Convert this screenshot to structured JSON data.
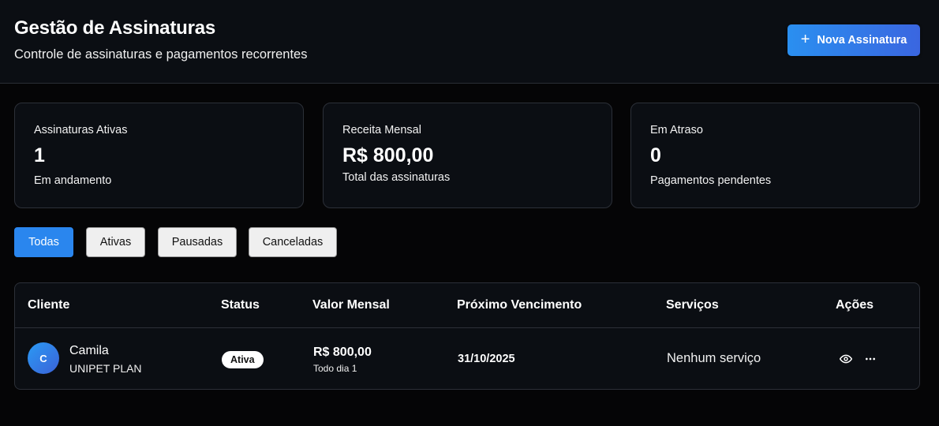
{
  "header": {
    "title": "Gestão de Assinaturas",
    "subtitle": "Controle de assinaturas e pagamentos recorrentes",
    "new_button_label": "Nova Assinatura",
    "new_button_icon": "plus-icon"
  },
  "stats": [
    {
      "label": "Assinaturas Ativas",
      "value": "1",
      "description": "Em andamento"
    },
    {
      "label": "Receita Mensal",
      "value": "R$ 800,00",
      "description": "Total das assinaturas"
    },
    {
      "label": "Em Atraso",
      "value": "0",
      "description": "Pagamentos pendentes"
    }
  ],
  "filters": [
    {
      "label": "Todas",
      "active": true
    },
    {
      "label": "Ativas",
      "active": false
    },
    {
      "label": "Pausadas",
      "active": false
    },
    {
      "label": "Canceladas",
      "active": false
    }
  ],
  "table": {
    "columns": [
      "Cliente",
      "Status",
      "Valor Mensal",
      "Próximo Vencimento",
      "Serviços",
      "Ações"
    ],
    "rows": [
      {
        "avatar_initial": "C",
        "client_name": "Camila",
        "plan": "UNIPET PLAN",
        "status": "Ativa",
        "amount": "R$ 800,00",
        "billing": "Todo dia 1",
        "next_due": "31/10/2025",
        "services": "Nenhum serviço",
        "actions": [
          "eye-icon",
          "more-horizontal-icon"
        ]
      }
    ]
  },
  "colors": {
    "accent": "#2a86ee",
    "background": "#050506",
    "surface": "#0b0e13",
    "border": "#2c3038"
  }
}
